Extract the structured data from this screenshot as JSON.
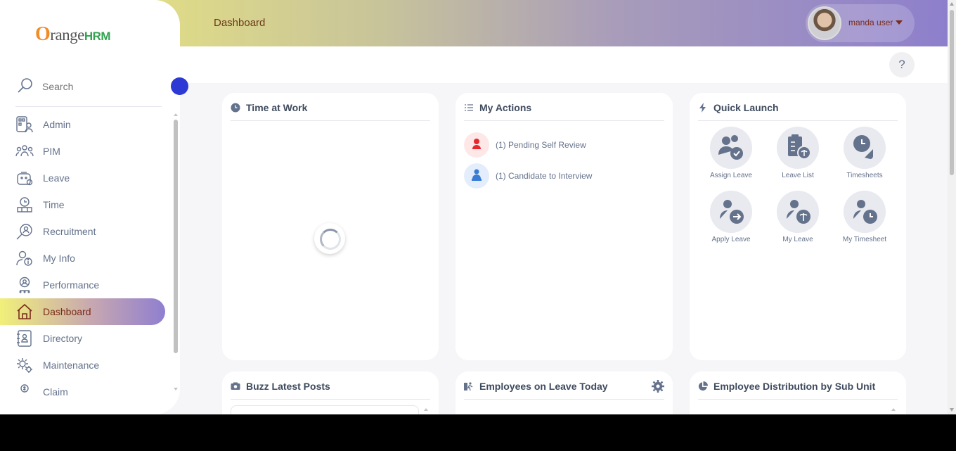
{
  "header": {
    "title": "Dashboard",
    "user_name": "manda user"
  },
  "brand": {
    "first": "O",
    "rest": "range",
    "suffix": "HRM"
  },
  "search": {
    "placeholder": "Search"
  },
  "sidebar": {
    "items": [
      {
        "label": "Admin",
        "icon": "admin-icon"
      },
      {
        "label": "PIM",
        "icon": "pim-icon"
      },
      {
        "label": "Leave",
        "icon": "leave-icon"
      },
      {
        "label": "Time",
        "icon": "time-icon"
      },
      {
        "label": "Recruitment",
        "icon": "recruitment-icon"
      },
      {
        "label": "My Info",
        "icon": "my-info-icon"
      },
      {
        "label": "Performance",
        "icon": "performance-icon"
      },
      {
        "label": "Dashboard",
        "icon": "home-icon",
        "active": true
      },
      {
        "label": "Directory",
        "icon": "directory-icon"
      },
      {
        "label": "Maintenance",
        "icon": "maintenance-icon"
      },
      {
        "label": "Claim",
        "icon": "claim-icon"
      }
    ]
  },
  "help": {
    "label": "?"
  },
  "cards": {
    "time_at_work": {
      "title": "Time at Work"
    },
    "my_actions": {
      "title": "My Actions",
      "items": [
        {
          "label": "(1) Pending Self Review",
          "color": "#e8272c"
        },
        {
          "label": "(1) Candidate to Interview",
          "color": "#3a7bd5"
        }
      ]
    },
    "quick_launch": {
      "title": "Quick Launch",
      "items": [
        {
          "label": "Assign Leave"
        },
        {
          "label": "Leave List"
        },
        {
          "label": "Timesheets"
        },
        {
          "label": "Apply Leave"
        },
        {
          "label": "My Leave"
        },
        {
          "label": "My Timesheet"
        }
      ]
    },
    "buzz": {
      "title": "Buzz Latest Posts"
    },
    "leave_today": {
      "title": "Employees on Leave Today"
    },
    "distribution": {
      "title": "Employee Distribution by Sub Unit"
    }
  },
  "colors": {
    "accent": "#8e7fcc",
    "brand_orange": "#f28c28",
    "brand_green": "#33a352",
    "text_muted": "#64728c",
    "active_text": "#7a2c1a"
  }
}
